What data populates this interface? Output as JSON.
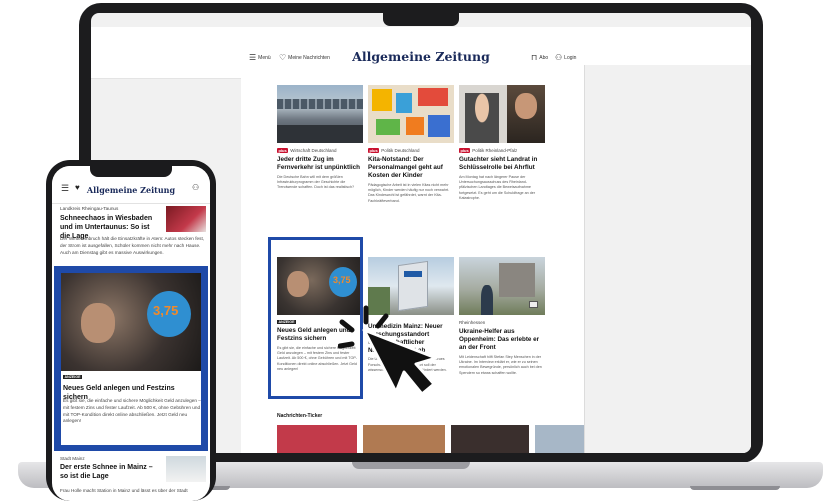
{
  "laptop_site": {
    "logo": "Allgemeine Zeitung",
    "menu_label": "Menü",
    "bookmarks_label": "Meine Nachrichten",
    "abo_label": "Abo",
    "login_label": "Login",
    "plus_badge": "plus",
    "ad_badge": "ANZEIGE",
    "section_ticker": "Nachrichten-Ticker",
    "articles": [
      {
        "kicker": "Wirtschaft Deutschland",
        "title": "Jeder dritte Zug im Fernverkehr ist unpünktlich",
        "teaser": "Die Deutsche Bahn will mit dem größten Infrastrukturprogramm der Geschichte die Trendwende schaffen. Doch ist das realistisch?"
      },
      {
        "kicker": "Politik Deutschland",
        "title": "Kita-Notstand: Der Personalmangel geht auf Kosten der Kinder",
        "teaser": "Pädagogische Arbeit ist in vielen Kitas nicht mehr möglich, Kinder werden häufig nur noch verwahrt. Das Kindeswohl ist gefährdet, warnt der Kita-Fachkräfteverband."
      },
      {
        "kicker": "Politik Rheinland-Pfalz",
        "title": "Gutachter sieht Landrat in Schlüsselrolle bei Ahrflut",
        "teaser": "Am Montag hat nach längerer Pause der Untersuchungsausschuss des Rheinland-pfälzischen Landtages die Beweisaufnahme fortgesetzt. Es geht um die Schuldfrage an der Katastrophe."
      },
      {
        "kicker": "",
        "title": "Neues Geld anlegen und Festzins sichern",
        "teaser": "Es gibt sie, die einfache und sichere Möglichkeit Geld anzulegen – mit festem Zins und fester Laufzeit. Ab 500 €, ohne Gebühren und mit TOP-Konditionen direkt online abschließen. Jetzt Geld neu anlegen!"
      },
      {
        "kicker": "",
        "title": "Unimedizin Mainz: Neuer Forschungsstandort wissenschaftlicher Nachwuchs gibt ab",
        "teaser": "Die Universitätsmedizin Mainz erhält ein neues Forschungszentrum. Am Standort soll der wissenschaftliche Nachwuchs gefördert werden."
      },
      {
        "kicker": "Rheinhessen",
        "title": "Ukraine-Helfer aus Oppenheim: Das erlebte er an der Front",
        "teaser": "Mit Leidenschaft hilft Stefan Stey Menschen in der Ukraine. Im Interview erklärt er, wie er zu seinen emotionalen Bewegründe, persönlich auch bei den Spendern so etwas schaffen wollte."
      }
    ],
    "teaser_numbers": "3,75"
  },
  "phone_site": {
    "logo": "Allgemeine Zeitung",
    "story1": {
      "kicker": "Landkreis Rheingau-Taunus",
      "title": "Schneechaos in Wiesbaden und im Untertaunus: So ist die Lage",
      "text": "Der Wintereinbruch hält die Einsatzkräfte in Atem: Autos stecken fest, der Strom ist ausgefallen, Schüler kommen nicht mehr nach Hause. Auch am Dienstag gibt es massive Auswirkungen."
    },
    "ad": {
      "badge": "ANZEIGE",
      "title": "Neues Geld anlegen und Festzins sichern",
      "text": "Es gibt sie, die einfache und sichere Möglichkeit Geld anzulegen – mit festem Zins und fester Laufzeit. Ab 500 €, ohne Gebühren und mit TOP-Kondition direkt online abschließen. Jetzt Geld neu anlegen!",
      "rate": "3,75"
    },
    "story2": {
      "kicker": "Stadt Mainz",
      "title": "Der erste Schnee in Mainz – so ist die Lage",
      "text": "Frau Holle macht Station in Mainz und lässt es über der Stadt"
    }
  },
  "colors": {
    "highlight": "#1f4aa8",
    "plus_badge": "#c8102e",
    "logo": "#1a2a5a"
  }
}
